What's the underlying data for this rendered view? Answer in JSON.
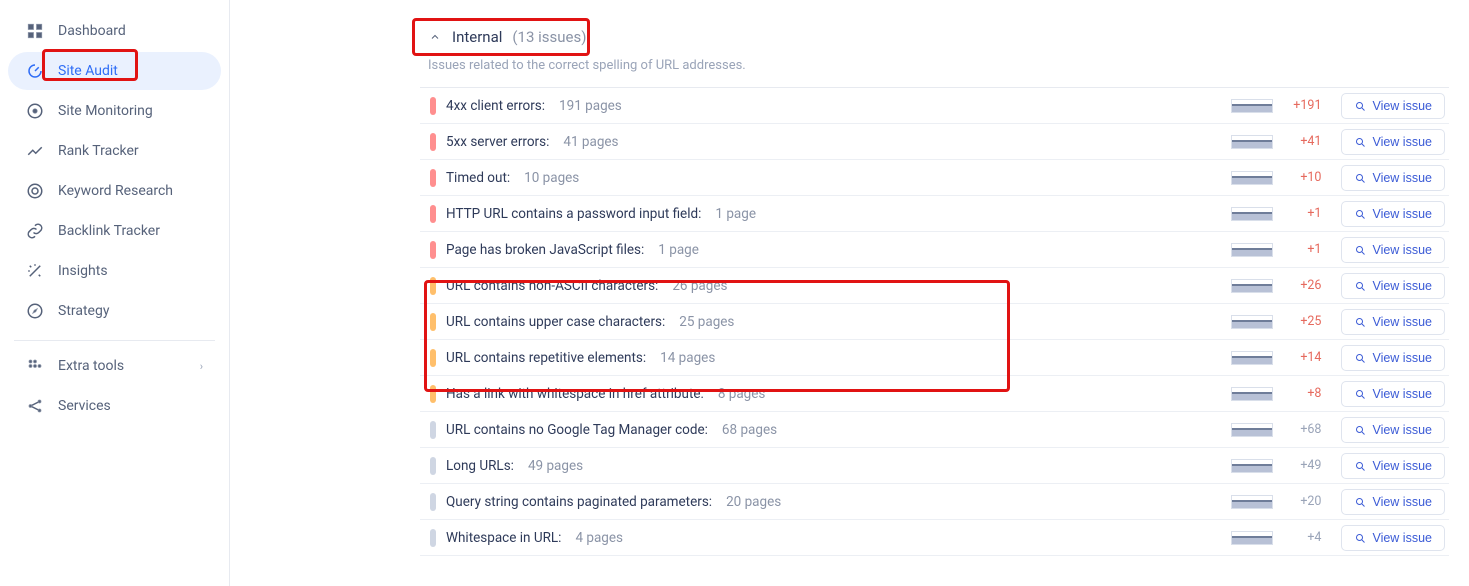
{
  "sidebar": {
    "items": [
      {
        "label": "Dashboard",
        "icon": "dashboard",
        "active": false
      },
      {
        "label": "Site Audit",
        "icon": "audit",
        "active": true
      },
      {
        "label": "Site Monitoring",
        "icon": "monitor",
        "active": false
      },
      {
        "label": "Rank Tracker",
        "icon": "rank",
        "active": false
      },
      {
        "label": "Keyword Research",
        "icon": "target",
        "active": false
      },
      {
        "label": "Backlink Tracker",
        "icon": "link",
        "active": false
      },
      {
        "label": "Insights",
        "icon": "wand",
        "active": false
      },
      {
        "label": "Strategy",
        "icon": "compass",
        "active": false
      }
    ],
    "extras": [
      {
        "label": "Extra tools",
        "icon": "apps",
        "expandable": true
      },
      {
        "label": "Services",
        "icon": "share",
        "expandable": false
      }
    ]
  },
  "section": {
    "title": "Internal",
    "count_label": "(13 issues)",
    "subtitle": "Issues related to the correct spelling of URL addresses."
  },
  "view_label": "View issue",
  "issues": [
    {
      "severity": "red",
      "label": "4xx client errors:",
      "pages": "191 pages",
      "delta": "+191",
      "delta_tone": "red"
    },
    {
      "severity": "red",
      "label": "5xx server errors:",
      "pages": "41 pages",
      "delta": "+41",
      "delta_tone": "red"
    },
    {
      "severity": "red",
      "label": "Timed out:",
      "pages": "10 pages",
      "delta": "+10",
      "delta_tone": "red"
    },
    {
      "severity": "red",
      "label": "HTTP URL contains a password input field:",
      "pages": "1 page",
      "delta": "+1",
      "delta_tone": "red"
    },
    {
      "severity": "red",
      "label": "Page has broken JavaScript files:",
      "pages": "1 page",
      "delta": "+1",
      "delta_tone": "red"
    },
    {
      "severity": "orange",
      "label": "URL contains non-ASCII characters:",
      "pages": "26 pages",
      "delta": "+26",
      "delta_tone": "red"
    },
    {
      "severity": "orange",
      "label": "URL contains upper case characters:",
      "pages": "25 pages",
      "delta": "+25",
      "delta_tone": "red"
    },
    {
      "severity": "orange",
      "label": "URL contains repetitive elements:",
      "pages": "14 pages",
      "delta": "+14",
      "delta_tone": "red"
    },
    {
      "severity": "orange",
      "label": "Has a link with whitespace in href attribute:",
      "pages": "8 pages",
      "delta": "+8",
      "delta_tone": "red"
    },
    {
      "severity": "gray",
      "label": "URL contains no Google Tag Manager code:",
      "pages": "68 pages",
      "delta": "+68",
      "delta_tone": "gray"
    },
    {
      "severity": "gray",
      "label": "Long URLs:",
      "pages": "49 pages",
      "delta": "+49",
      "delta_tone": "gray"
    },
    {
      "severity": "gray",
      "label": "Query string contains paginated parameters:",
      "pages": "20 pages",
      "delta": "+20",
      "delta_tone": "gray"
    },
    {
      "severity": "gray",
      "label": "Whitespace in URL:",
      "pages": "4 pages",
      "delta": "+4",
      "delta_tone": "gray"
    }
  ]
}
